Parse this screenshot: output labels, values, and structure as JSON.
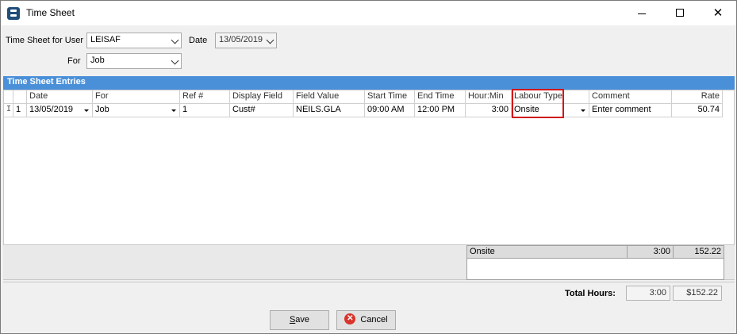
{
  "window": {
    "title": "Time Sheet",
    "minimize_glyph": "",
    "close_glyph": "✕"
  },
  "form": {
    "user_label": "Time Sheet for User",
    "user_value": "LEISAF",
    "date_label": "Date",
    "date_value": "13/05/2019",
    "for_label": "For",
    "for_value": "Job"
  },
  "entries": {
    "section_title": "Time Sheet Entries",
    "columns": [
      "Date",
      "For",
      "Ref #",
      "Display Field",
      "Field Value",
      "Start Time",
      "End Time",
      "Hour:Min",
      "Labour Type",
      "Comment",
      "Rate"
    ],
    "rows": [
      {
        "indicator": "I",
        "index": "1",
        "date": "13/05/2019",
        "for": "Job",
        "ref": "1",
        "display_field": "Cust#",
        "field_value": "NEILS.GLA",
        "start_time": "09:00 AM",
        "end_time": "12:00 PM",
        "hour_min": "3:00",
        "labour_type": "Onsite",
        "comment": "Enter comment",
        "rate": "50.74"
      }
    ]
  },
  "summary": {
    "rows": [
      {
        "labour_type": "Onsite",
        "hours": "3:00",
        "amount": "152.22"
      }
    ]
  },
  "totals": {
    "label": "Total Hours:",
    "hours": "3:00",
    "amount": "$152.22"
  },
  "buttons": {
    "save_prefix": "",
    "save_mnemonic": "S",
    "save_rest": "ave",
    "cancel_label": "Cancel"
  },
  "colors": {
    "section_header": "#4a90d9",
    "highlight": "#d0171b"
  },
  "icons": {
    "app": "app-icon",
    "cancel": "cancel-icon"
  }
}
